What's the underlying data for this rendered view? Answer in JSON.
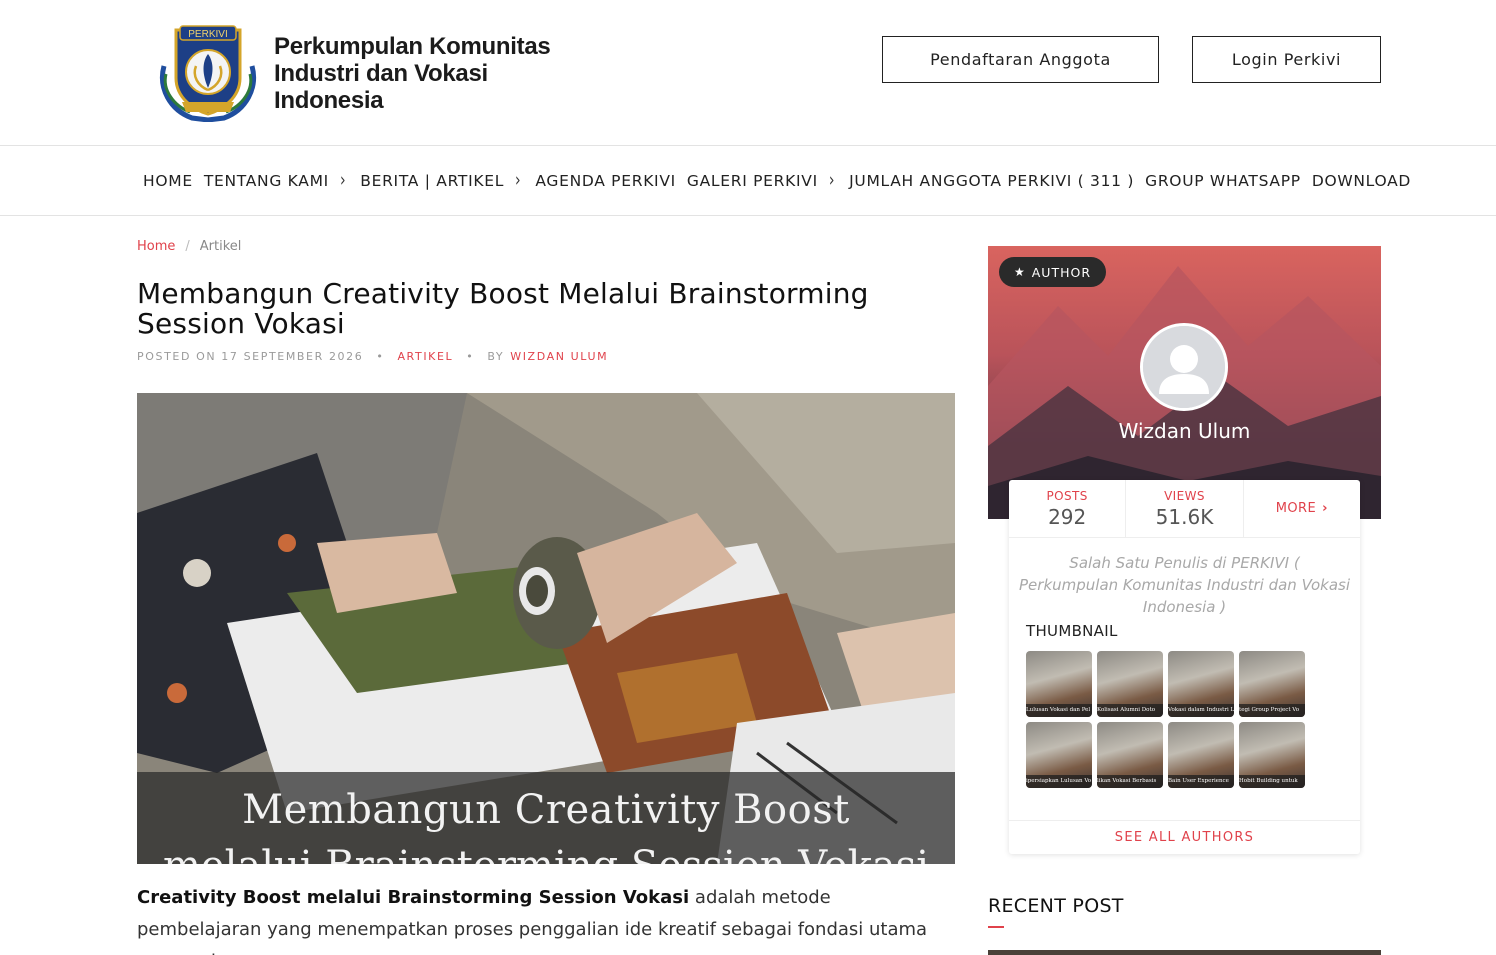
{
  "header": {
    "logo_label": "PERKIVI",
    "site_name": "Perkumpulan Komunitas Industri dan Vokasi Indonesia",
    "register_label": "Pendaftaran Anggota",
    "login_label": "Login Perkivi"
  },
  "nav": {
    "items": [
      {
        "label": "HOME",
        "has_submenu": false
      },
      {
        "label": "TENTANG KAMI",
        "has_submenu": true
      },
      {
        "label": "BERITA | ARTIKEL",
        "has_submenu": true
      },
      {
        "label": "AGENDA PERKIVI",
        "has_submenu": false
      },
      {
        "label": "GALERI PERKIVI",
        "has_submenu": true
      },
      {
        "label": "JUMLAH ANGGOTA PERKIVI ( 311 )",
        "has_submenu": false
      },
      {
        "label": "GROUP WHATSAPP",
        "has_submenu": false
      },
      {
        "label": "DOWNLOAD",
        "has_submenu": false
      }
    ]
  },
  "breadcrumb": {
    "home": "Home",
    "separator": "/",
    "current": "Artikel"
  },
  "post": {
    "title": "Membangun Creativity Boost Melalui Brainstorming Session Vokasi",
    "posted_on": "POSTED ON 17 SEPTEMBER 2026",
    "category": "ARTIKEL",
    "by_label": "BY",
    "author": "WIZDAN ULUM",
    "hero_caption_line1": "Membangun Creativity Boost",
    "hero_caption_line2": "melalui Brainstorming Session Vokasi",
    "intro_bold": "Creativity Boost melalui Brainstorming Session Vokasi",
    "intro_rest": " adalah metode pembelajaran yang menempatkan proses penggalian ide kreatif sebagai fondasi utama pengembangan"
  },
  "author_widget": {
    "badge_label": "AUTHOR",
    "name": "Wizdan Ulum",
    "stats": {
      "posts_label": "POSTS",
      "posts_value": "292",
      "views_label": "VIEWS",
      "views_value": "51.6K",
      "more_label": "MORE"
    },
    "description": "Salah Satu Penulis di PERKIVI ( Perkumpulan Komunitas Industri dan Vokasi Indonesia )",
    "thumbnail_title": "THUMBNAIL",
    "thumbnails": [
      {
        "caption": "Lulusan Vokasi dan Pel"
      },
      {
        "caption": "Kolisasi Alumni Doto"
      },
      {
        "caption": "Vokasi dalam Industri La"
      },
      {
        "caption": "tegi Group Project Vo"
      },
      {
        "caption": "ipersiapkan Lulusan Vo"
      },
      {
        "caption": "likan Vokasi Berbasis"
      },
      {
        "caption": "Bain User Experience"
      },
      {
        "caption": "Hobit Building untuk"
      }
    ],
    "see_all_label": "SEE ALL AUTHORS"
  },
  "sidebar": {
    "recent_post_title": "RECENT POST"
  },
  "colors": {
    "accent": "#e0424b",
    "text_dark": "#111111",
    "muted": "#9a9a9a"
  }
}
